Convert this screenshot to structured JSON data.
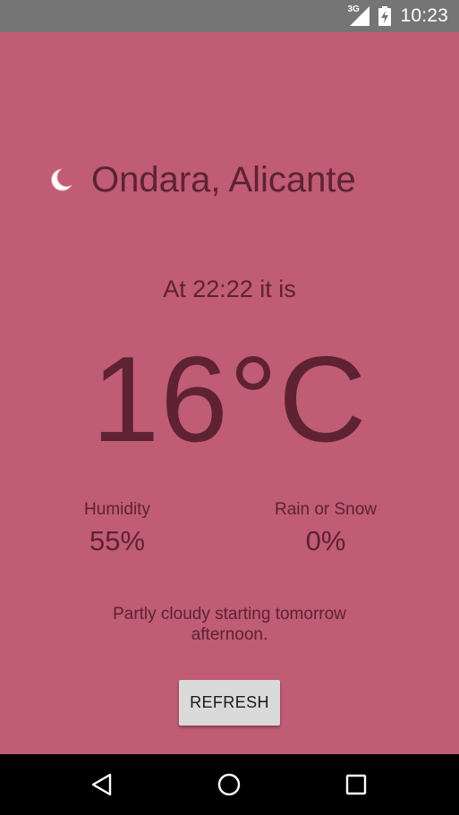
{
  "status_bar": {
    "network_label": "3G",
    "time": "10:23",
    "icons": [
      "signal-icon",
      "battery-charging-icon"
    ]
  },
  "weather": {
    "condition_icon": "moon-icon",
    "location": "Ondara, Alicante",
    "time_line": "At 22:22 it is",
    "temperature": "16°C",
    "humidity_label": "Humidity",
    "humidity_value": "55%",
    "precip_label": "Rain or Snow",
    "precip_value": "0%",
    "forecast": "Partly cloudy starting tomorrow afternoon."
  },
  "actions": {
    "refresh_label": "REFRESH"
  },
  "nav_bar": {
    "icons": [
      "back-icon",
      "home-icon",
      "recents-icon"
    ]
  },
  "colors": {
    "background": "#c05c74",
    "text": "#5e2233",
    "status_bar": "#757575",
    "nav_bar": "#000000",
    "button": "#dadada"
  }
}
